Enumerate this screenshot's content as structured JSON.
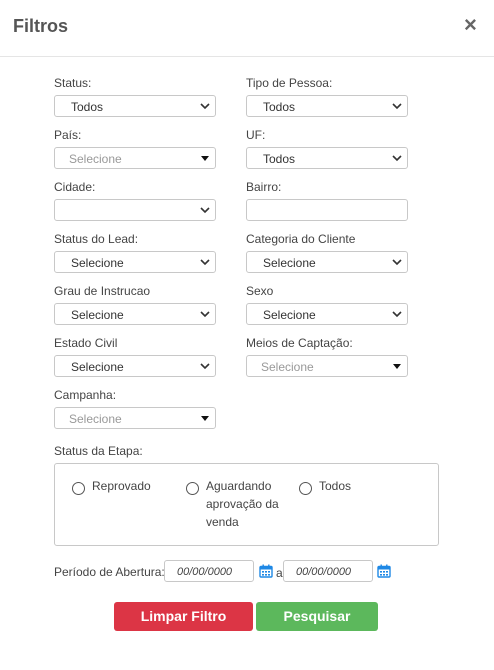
{
  "modal": {
    "title": "Filtros",
    "close_glyph": "×"
  },
  "fields": {
    "status": {
      "label": "Status:",
      "value": "Todos"
    },
    "tipo_pessoa": {
      "label": "Tipo de Pessoa:",
      "value": "Todos"
    },
    "pais": {
      "label": "País:",
      "placeholder": "Selecione"
    },
    "uf": {
      "label": "UF:",
      "value": "Todos"
    },
    "cidade": {
      "label": "Cidade:",
      "value": ""
    },
    "bairro": {
      "label": "Bairro:",
      "value": ""
    },
    "status_lead": {
      "label": "Status do Lead:",
      "value": "Selecione"
    },
    "categoria_cliente": {
      "label": "Categoria do Cliente",
      "value": "Selecione"
    },
    "grau_instrucao": {
      "label": "Grau de Instrucao",
      "value": "Selecione"
    },
    "sexo": {
      "label": "Sexo",
      "value": "Selecione"
    },
    "estado_civil": {
      "label": "Estado Civil",
      "value": "Selecione"
    },
    "meios_captacao": {
      "label": "Meios de Captação:",
      "placeholder": "Selecione"
    },
    "campanha": {
      "label": "Campanha:",
      "placeholder": "Selecione"
    }
  },
  "status_etapa": {
    "label": "Status da Etapa:",
    "options": [
      {
        "label": "Reprovado"
      },
      {
        "label_lines": [
          "Aguardando",
          "aprovação da",
          "venda"
        ]
      },
      {
        "label": "Todos"
      }
    ]
  },
  "periodo": {
    "label": "Período de Abertura:",
    "separator": "a",
    "start_placeholder": "00/00/0000",
    "end_placeholder": "00/00/0000"
  },
  "buttons": {
    "clear": "Limpar Filtro",
    "search": "Pesquisar"
  },
  "colors": {
    "clear_button": "#dc3545",
    "search_button": "#5cb85c",
    "calendar_icon": "#1e88e5"
  },
  "icons": {
    "close": "close-icon",
    "select_chevron": "chevron-down-icon",
    "select_caret": "caret-down-icon",
    "calendar": "calendar-icon"
  }
}
